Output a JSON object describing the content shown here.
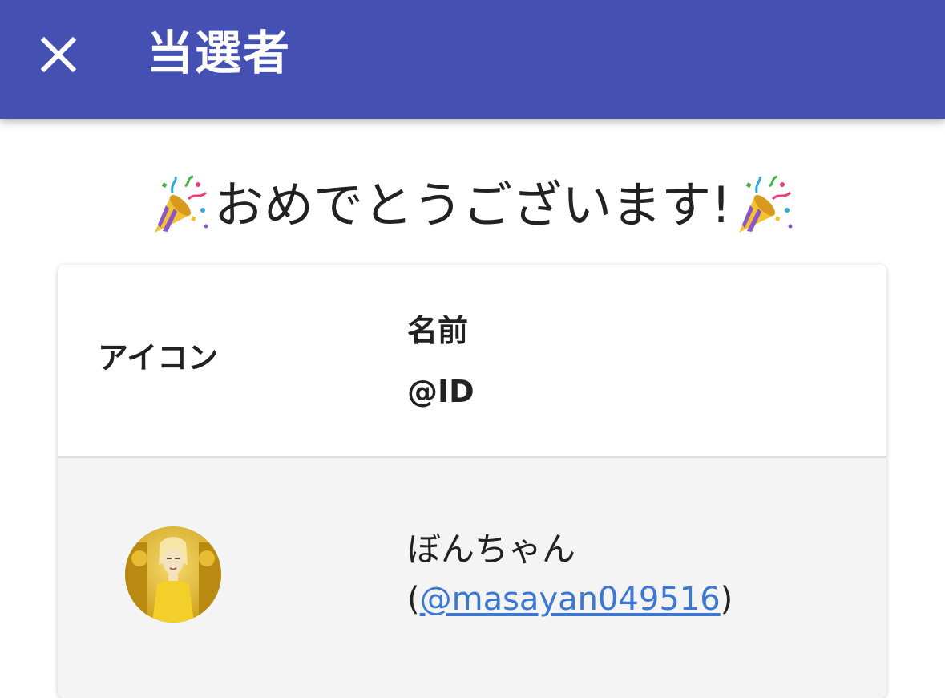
{
  "app_bar": {
    "title": "当選者",
    "close_icon": "close-icon",
    "background": "#4450b2"
  },
  "headline": {
    "text": "おめでとうございます!",
    "icon": "party-popper-icon"
  },
  "table": {
    "headers": {
      "icon": "アイコン",
      "name": "名前",
      "id": "@ID"
    },
    "rows": [
      {
        "name": "ぼんちゃん",
        "id_prefix": "(",
        "id": "@masayan049516",
        "id_suffix": ")",
        "avatar": "avatar-image"
      }
    ]
  },
  "colors": {
    "link": "#3b78d4",
    "row_background": "#f4f4f4"
  }
}
